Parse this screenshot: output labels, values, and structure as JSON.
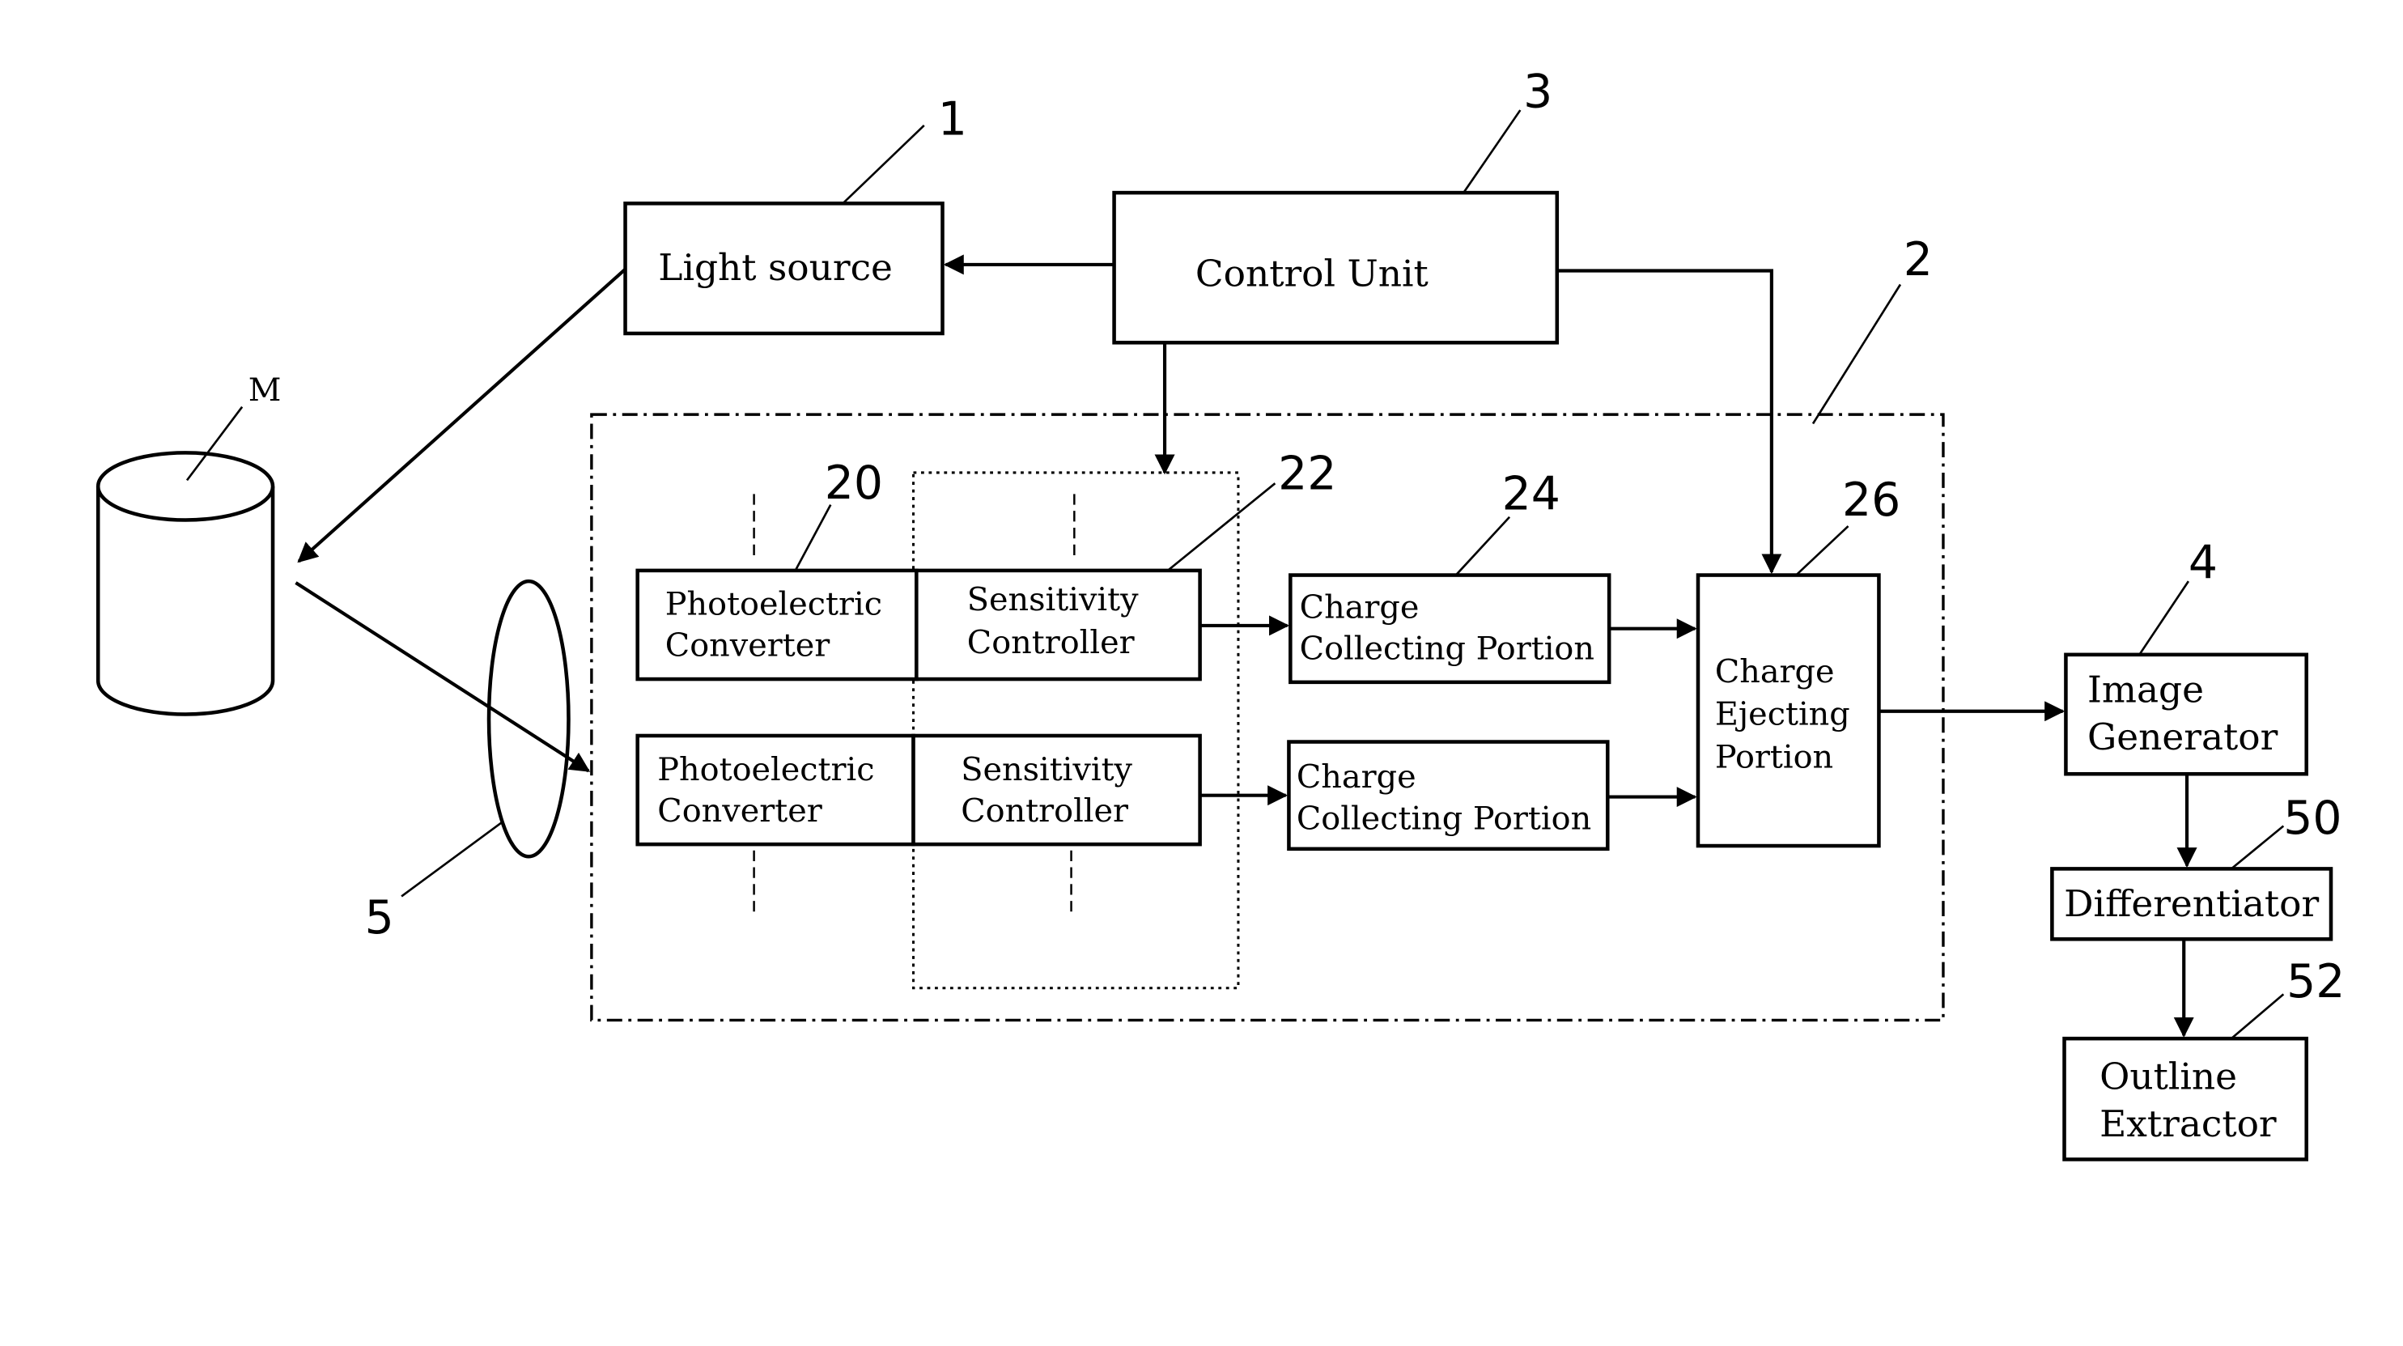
{
  "diagram": {
    "blocks": {
      "light_source": {
        "ref": "1",
        "lines": [
          "Light source"
        ]
      },
      "control_unit": {
        "ref": "3",
        "lines": [
          "Control Unit"
        ]
      },
      "sensor_unit": {
        "ref": "2"
      },
      "object": {
        "ref": "M"
      },
      "lens": {
        "ref": "5"
      },
      "photoelectric_1": {
        "ref": "20",
        "lines": [
          "Photoelectric",
          "Converter"
        ]
      },
      "photoelectric_2": {
        "lines": [
          "Photoelectric",
          "Converter"
        ]
      },
      "sensitivity_group": {
        "ref": "22"
      },
      "sensitivity_1": {
        "lines": [
          "Sensitivity",
          "Controller"
        ]
      },
      "sensitivity_2": {
        "lines": [
          "Sensitivity",
          "Controller"
        ]
      },
      "charge_collecting_1": {
        "ref": "24",
        "lines": [
          "Charge",
          "Collecting Portion"
        ]
      },
      "charge_collecting_2": {
        "lines": [
          "Charge",
          "Collecting Portion"
        ]
      },
      "charge_ejecting": {
        "ref": "26",
        "lines": [
          "Charge",
          "Ejecting",
          "Portion"
        ]
      },
      "image_generator": {
        "ref": "4",
        "lines": [
          "Image",
          "Generator"
        ]
      },
      "differentiator": {
        "ref": "50",
        "lines": [
          "Differentiator"
        ]
      },
      "outline_extractor": {
        "ref": "52",
        "lines": [
          "Outline",
          "Extractor"
        ]
      }
    },
    "connections": [
      {
        "from": "control_unit",
        "to": "light_source"
      },
      {
        "from": "control_unit",
        "to": "sensitivity_group"
      },
      {
        "from": "control_unit",
        "to": "charge_ejecting"
      },
      {
        "from": "light_source",
        "to": "object"
      },
      {
        "from": "object",
        "to": "sensor_unit",
        "via": "lens"
      },
      {
        "from": "sensitivity_1",
        "to": "charge_collecting_1"
      },
      {
        "from": "sensitivity_2",
        "to": "charge_collecting_2"
      },
      {
        "from": "charge_collecting_1",
        "to": "charge_ejecting"
      },
      {
        "from": "charge_collecting_2",
        "to": "charge_ejecting"
      },
      {
        "from": "charge_ejecting",
        "to": "image_generator"
      },
      {
        "from": "image_generator",
        "to": "differentiator"
      },
      {
        "from": "differentiator",
        "to": "outline_extractor"
      }
    ]
  }
}
